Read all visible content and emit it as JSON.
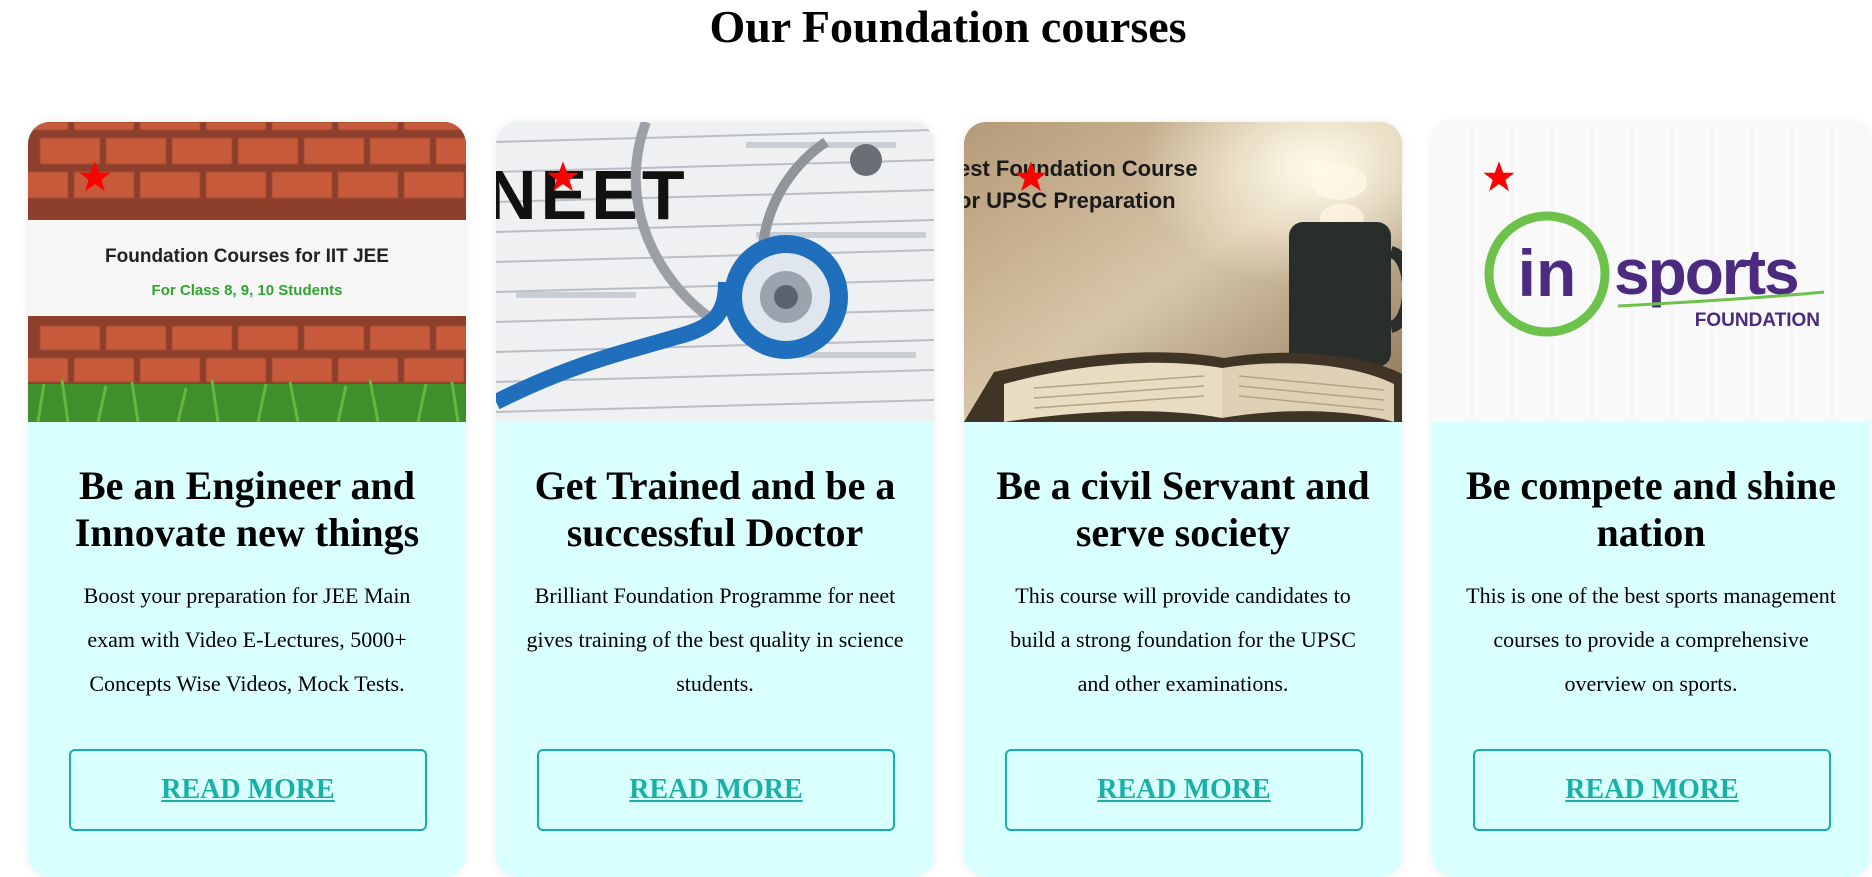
{
  "page": {
    "title": "Our Foundation courses"
  },
  "cards": [
    {
      "image_text_1": "Foundation Courses for IIT JEE",
      "image_text_2": "For Class 8, 9, 10 Students",
      "title": "Be an Engineer and Innovate new things",
      "description": "Boost your preparation for JEE Main exam with Video E-Lectures, 5000+ Concepts Wise Videos, Mock Tests.",
      "button": "READ MORE"
    },
    {
      "image_text_1": "NEET",
      "title": "Get Trained and be a successful Doctor",
      "description": "Brilliant Foundation Programme for neet gives training of the best quality in science students.",
      "button": "READ MORE"
    },
    {
      "image_text_1": "est Foundation Course",
      "image_text_2": "or UPSC Preparation",
      "title": "Be a civil Servant and serve society",
      "description": "This course will provide candidates to build a strong foundation for the UPSC and other examinations.",
      "button": "READ MORE"
    },
    {
      "image_text_1": "in",
      "image_text_2": "sports",
      "image_text_3": "FOUNDATION",
      "title": "Be compete and shine nation",
      "description": "This is one of the best sports management courses to provide a comprehensive overview on sports.",
      "button": "READ MORE"
    }
  ],
  "colors": {
    "card_background": "#d9fffe",
    "button_accent": "#19b0a8",
    "star": "#ff0000"
  }
}
